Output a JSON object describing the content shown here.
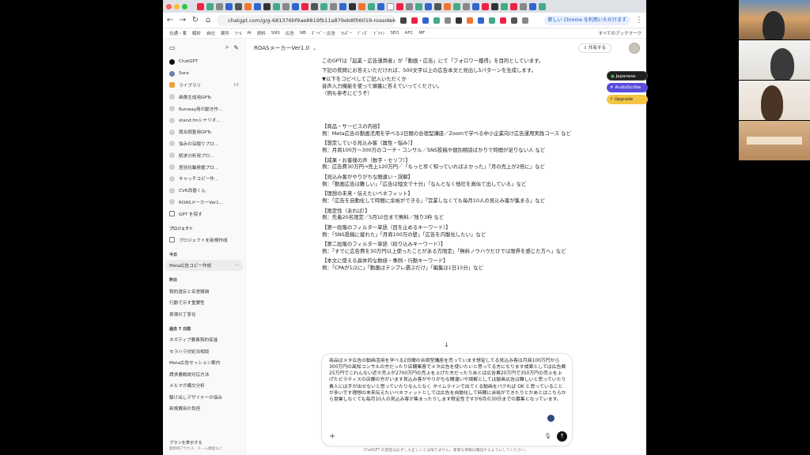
{
  "browser": {
    "url": "chatgpt.com/g/g-681376bf9ae8819fb11a879eb8f06019-roasmekav...",
    "update_button": "新しい Chrome を利用いただけます",
    "bookmarks": [
      "交通・東",
      "解析",
      "自社",
      "案件",
      "ﾂｰﾙ",
      "AI",
      "資料",
      "SNS",
      "広告",
      "NB",
      "ﾎﾞｰﾄﾞ・広告",
      "ﾅﾚﾎﾞｰ",
      "ﾃﾞｨｶﾞ",
      "ﾄﾞﾒｲﾝ",
      "SEO",
      "AFC",
      "MF"
    ],
    "bookmarks_right": "すべてのブックマーク"
  },
  "sidebar": {
    "top_items": [
      {
        "label": "ChatGPT",
        "count": ""
      },
      {
        "label": "Sora",
        "count": ""
      },
      {
        "label": "ライブラリ",
        "count": "16"
      }
    ],
    "gpts": [
      "画像生成用GPTs",
      "Runway用の動き作...",
      "stand.fmシナリオ...",
      "競合調査用GPTs",
      "悩みの深掘りプロ...",
      "統求分析用プロ...",
      "差別化軸発掘プロ...",
      "キャッチコピー作...",
      "CVR改善くん",
      "ROASメーカーVer1...",
      "GPT を探す"
    ],
    "project_head": "プロジェクト",
    "new_project": "プロジェクトを新規作成",
    "today_head": "今日",
    "today_items": [
      "Meta広告コピー作成"
    ],
    "yesterday_head": "昨日",
    "yesterday_items": [
      "契約違反と名誉毀損",
      "行動で示す重要性",
      "表現の丁寧化"
    ],
    "week_head": "過去 7 日間",
    "week_items": [
      "ネガティブ要素契約促進",
      "モラハラ対処法相談",
      "Meta広告セッション案内",
      "請求書概説対応方法",
      "メルマガ構文分析",
      "駆け出しデザイナーの悩み",
      "新規費用の負担"
    ],
    "footer_title": "プランを表示する",
    "footer_sub": "無制限アクセス、チーム機能など"
  },
  "main": {
    "title": "ROASメーカーVer1.0",
    "share": "共有する",
    "intro": [
      "このGPTは「起業・広告運用者」が「動画・広告」にて「フォロワー獲得」を目的としています。",
      "下記の質問にお答えいただければ、500文字以上の広告本文と見出し5パターンを生成します。",
      "▼以下をコピペしてご記入いただくか",
      "音声入力機能を使って順番に答えていってください。",
      "（例も参考にどうぞ）"
    ],
    "sections": [
      {
        "h": "【商品・サービスの内容】",
        "ex": "例：Meta広告の動画活用を学べる2日間の合宿型講座／Zoomで学べる中小企業向け広告運用実践コース など"
      },
      {
        "h": "【想定している見込み客（属性・悩み）】",
        "ex": "例：月商100万〜300万のコーチ・コンサル／SNS投稿や個別相談ばかりで時間が足りない人 など"
      },
      {
        "h": "【成果・お客様の声（数字・セリフ）】",
        "ex": "例：広告費30万円→売上120万円／「もっと早く知っていればよかった」「月の売上が2倍に」など"
      },
      {
        "h": "【見込み客がやりがちな間違い・誤解】",
        "ex": "例：「動画広告は難しい」「広告は短文で十分」「なんとなく他社を真似て出している」など"
      },
      {
        "h": "【理想の未来・伝えたいベネフィット】",
        "ex": "例：「広告を自動化して時間に余裕ができる」「営業しなくても毎月10人の見込み客が集まる」など"
      },
      {
        "h": "【限定性（あれば）】",
        "ex": "例：先着20名限定／5月10日まで無料／残り3枠 など"
      },
      {
        "h": "【第一段階のフィルター単語（目を止めるキーワード）】",
        "ex": "例：「SNS投稿に疲れた」「月商100万の壁」「広告を内製化したい」など"
      },
      {
        "h": "【第二段階のフィルター単語（絞り込みキーワード）】",
        "ex": "例：「すでに広告費を30万円以上使ったことがある方限定」「無料ノウハウだけでは限界を感じた方へ」など"
      },
      {
        "h": "【本文に使える具体的な数値・事例・行動キーワード】",
        "ex": "例：「CPAが1/2に」「動画はテンプレ選ぶだけ」「編集は1日15分」など"
      }
    ],
    "composer_text": "商品はメタ広告の動画活用を学べる2日間の合宿型講座を売っています想定してる見込み客は月商100万円から300万円の高知コンサルの方だったり店舗集客でメタ広告を使いたいと思ってる方になります成果としては広告費25万円でこれんない近々売上が2700万円の売上を上げた方だったりあとは広告費20万円で350万円の売上を上げたピラティスの店舗の方がいます見込み客がやりがちな間違いや誤解としては動画広告は難しいと思っていたり素人には手が出せないと思っていたりなんとなく タイムラインで出てくる動画をパクれば OK と思っていることが多いです理想の未来伝えたいベネフィットとしては広告を自動化して時間に余裕ができたりとかあとはこちらから営業しなくても毎月10人の見込み客が集まったりします限定性ですが6月の30日までの募集となっています。",
    "disclaimer": "ChatGPT の回答は必ずしも正しいとは限りません。重要な情報は確認するようにしてください。"
  },
  "extension": {
    "language": "Japanese",
    "audio": "AudioScribe",
    "upgrade": "Upgrade"
  },
  "colors": {
    "accent_purple": "#5b4cdb",
    "upgrade_yellow": "#f4c542",
    "sidebar_bg": "#f9f9f9"
  }
}
